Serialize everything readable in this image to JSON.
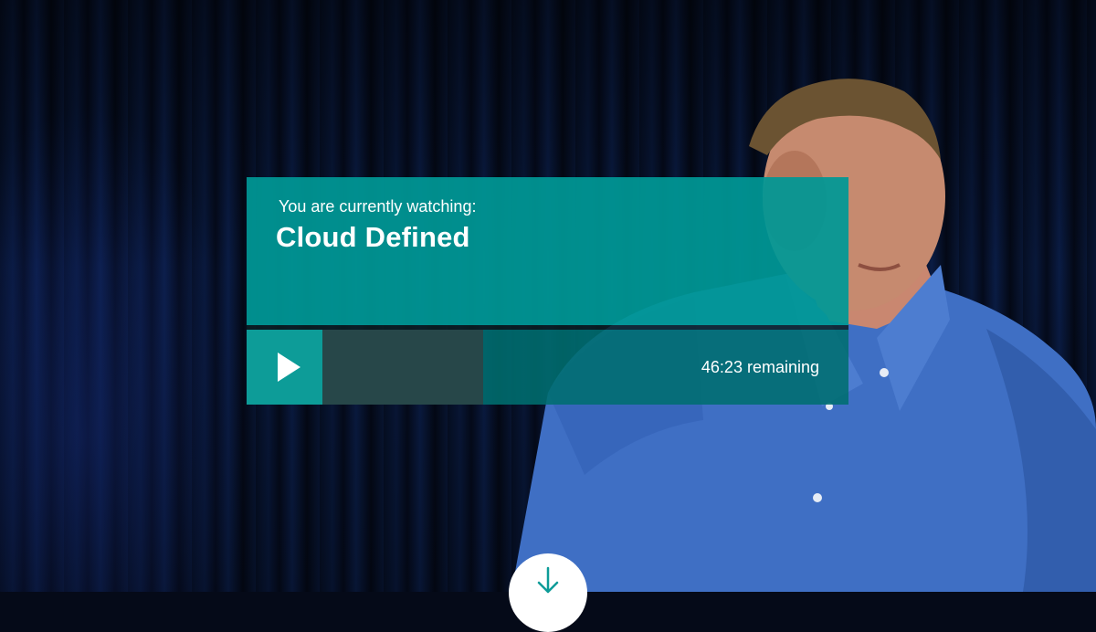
{
  "player": {
    "watching_label": "You are currently watching:",
    "title": "Cloud Defined",
    "remaining": "46:23 remaining",
    "progress_fraction": 0.306
  },
  "icons": {
    "play": "play-icon",
    "scroll": "arrow-down-icon"
  },
  "colors": {
    "accent": "#009896",
    "play_button": "#0d9c98",
    "progress_fill": "#284648",
    "progress_track": "#006e70"
  }
}
